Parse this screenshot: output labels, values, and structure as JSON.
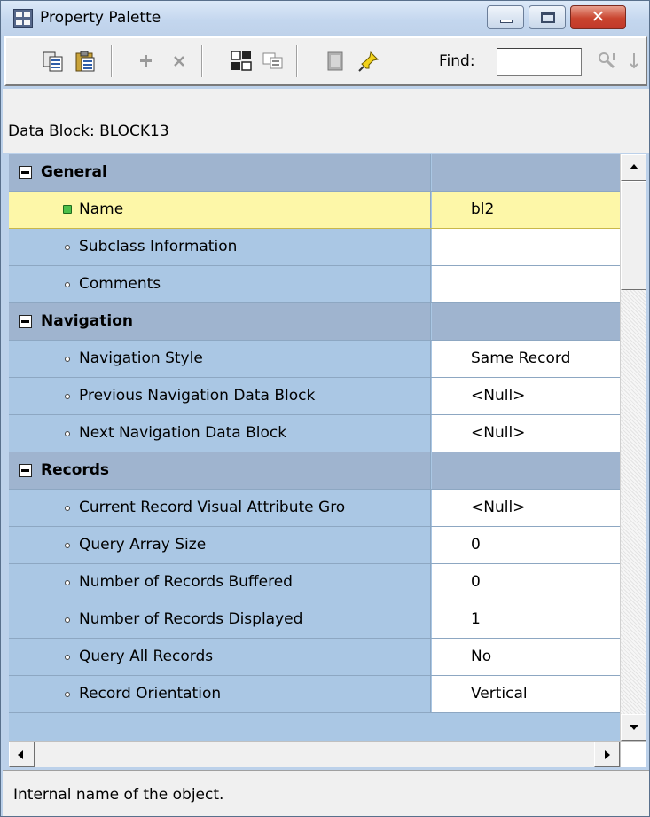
{
  "window": {
    "title": "Property Palette"
  },
  "toolbar": {
    "buttons": [
      {
        "name": "copy-properties-icon"
      },
      {
        "name": "paste-properties-icon"
      },
      {
        "name": "add-property-icon"
      },
      {
        "name": "delete-property-icon"
      },
      {
        "name": "union-icon"
      },
      {
        "name": "intersection-icon"
      },
      {
        "name": "inherit-icon"
      },
      {
        "name": "freeze-pin-icon"
      }
    ],
    "find_label": "Find:",
    "find_value": "",
    "trailing_icon": "search-next-icon"
  },
  "context": {
    "label": "Data Block: BLOCK13"
  },
  "properties": {
    "general": {
      "label": "General",
      "name": {
        "label": "Name",
        "value": "bl2"
      },
      "subclass": {
        "label": "Subclass Information",
        "value": ""
      },
      "comments": {
        "label": "Comments",
        "value": ""
      }
    },
    "navigation": {
      "label": "Navigation",
      "style": {
        "label": "Navigation Style",
        "value": "Same Record"
      },
      "previous": {
        "label": "Previous Navigation Data Block",
        "value": "<Null>"
      },
      "next": {
        "label": "Next Navigation Data Block",
        "value": "<Null>"
      }
    },
    "records": {
      "label": "Records",
      "current_va": {
        "label": "Current Record Visual Attribute Gro",
        "value": "<Null>"
      },
      "query_array": {
        "label": "Query Array Size",
        "value": "0"
      },
      "buffered": {
        "label": "Number of Records Buffered",
        "value": "0"
      },
      "displayed": {
        "label": "Number of Records Displayed",
        "value": "1"
      },
      "query_all": {
        "label": "Query All Records",
        "value": "No"
      },
      "orientation": {
        "label": "Record Orientation",
        "value": "Vertical"
      }
    }
  },
  "status": {
    "text": "Internal name of the object."
  },
  "colors": {
    "category_row": "#9fb4cf",
    "property_row": "#aac7e4",
    "selected_row": "#fdf7a8",
    "active_bullet": "#4cbf4a"
  }
}
